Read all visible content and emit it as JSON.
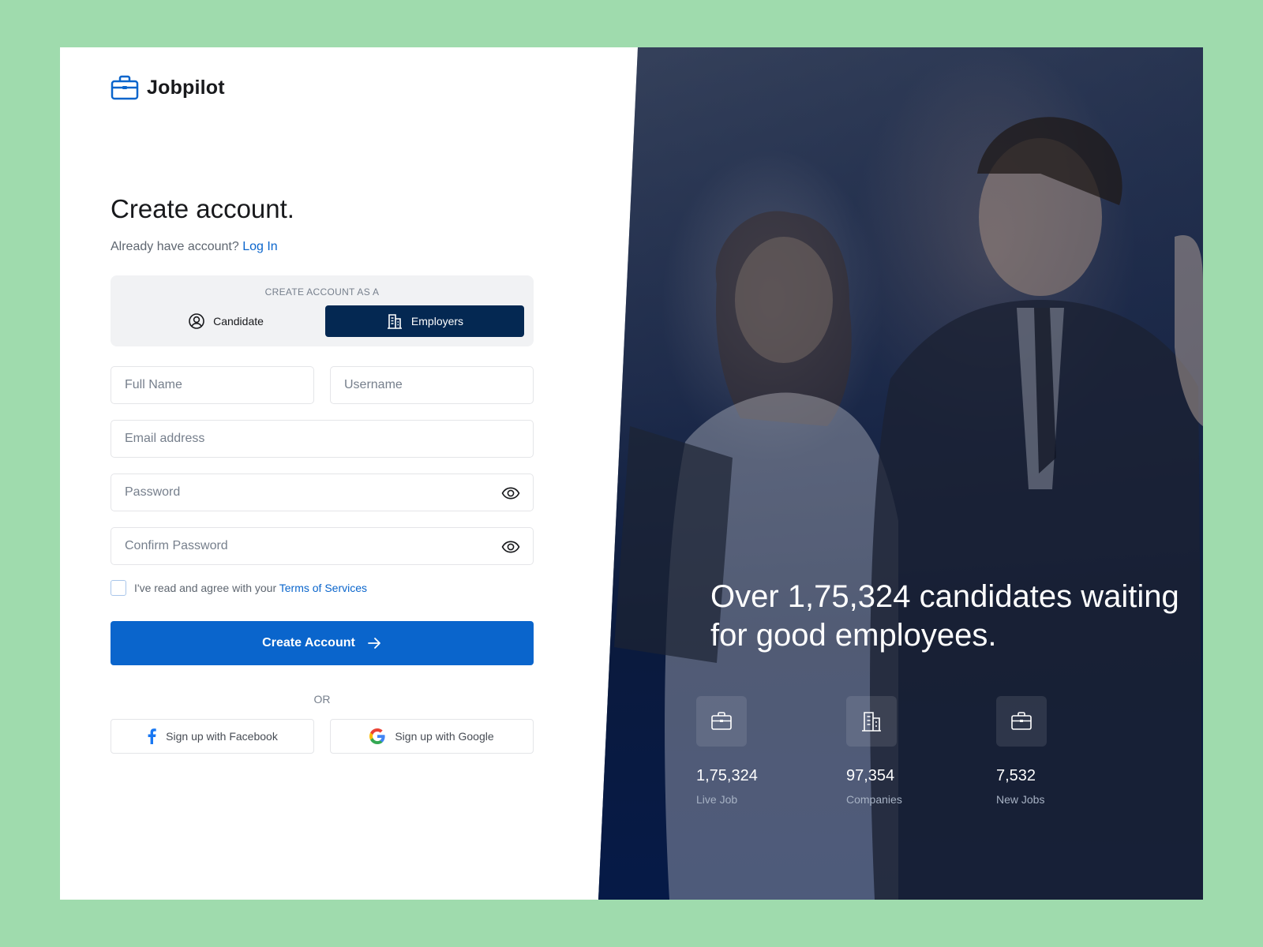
{
  "brand": {
    "name": "Jobpilot"
  },
  "form": {
    "heading": "Create account.",
    "already_text": "Already have account? ",
    "login_link": "Log In",
    "role": {
      "caption": "CREATE ACCOUNT AS A",
      "options": [
        {
          "label": "Candidate",
          "icon": "user-circle-icon",
          "selected": false
        },
        {
          "label": "Employers",
          "icon": "building-icon",
          "selected": true
        }
      ]
    },
    "fields": {
      "full_name": {
        "placeholder": "Full Name",
        "value": ""
      },
      "username": {
        "placeholder": "Username",
        "value": ""
      },
      "email": {
        "placeholder": "Email address",
        "value": ""
      },
      "password": {
        "placeholder": "Password",
        "value": ""
      },
      "confirm_password": {
        "placeholder": "Confirm Password",
        "value": ""
      }
    },
    "terms": {
      "checked": false,
      "text": "I've read and agree with your ",
      "link": "Terms of Services"
    },
    "submit_label": "Create Account",
    "or_label": "OR",
    "social": {
      "facebook": "Sign up with Facebook",
      "google": "Sign up with Google"
    }
  },
  "hero": {
    "title": "Over 1,75,324 candidates waiting for good employees.",
    "stats": [
      {
        "value": "1,75,324",
        "label": "Live Job",
        "icon": "briefcase-icon"
      },
      {
        "value": "97,354",
        "label": "Companies",
        "icon": "building-icon"
      },
      {
        "value": "7,532",
        "label": "New Jobs",
        "icon": "briefcase-icon"
      }
    ]
  },
  "colors": {
    "primary": "#0a65cc",
    "navy": "#042852",
    "page_bg": "#9fdbad",
    "hero_bg": "#061a47"
  }
}
